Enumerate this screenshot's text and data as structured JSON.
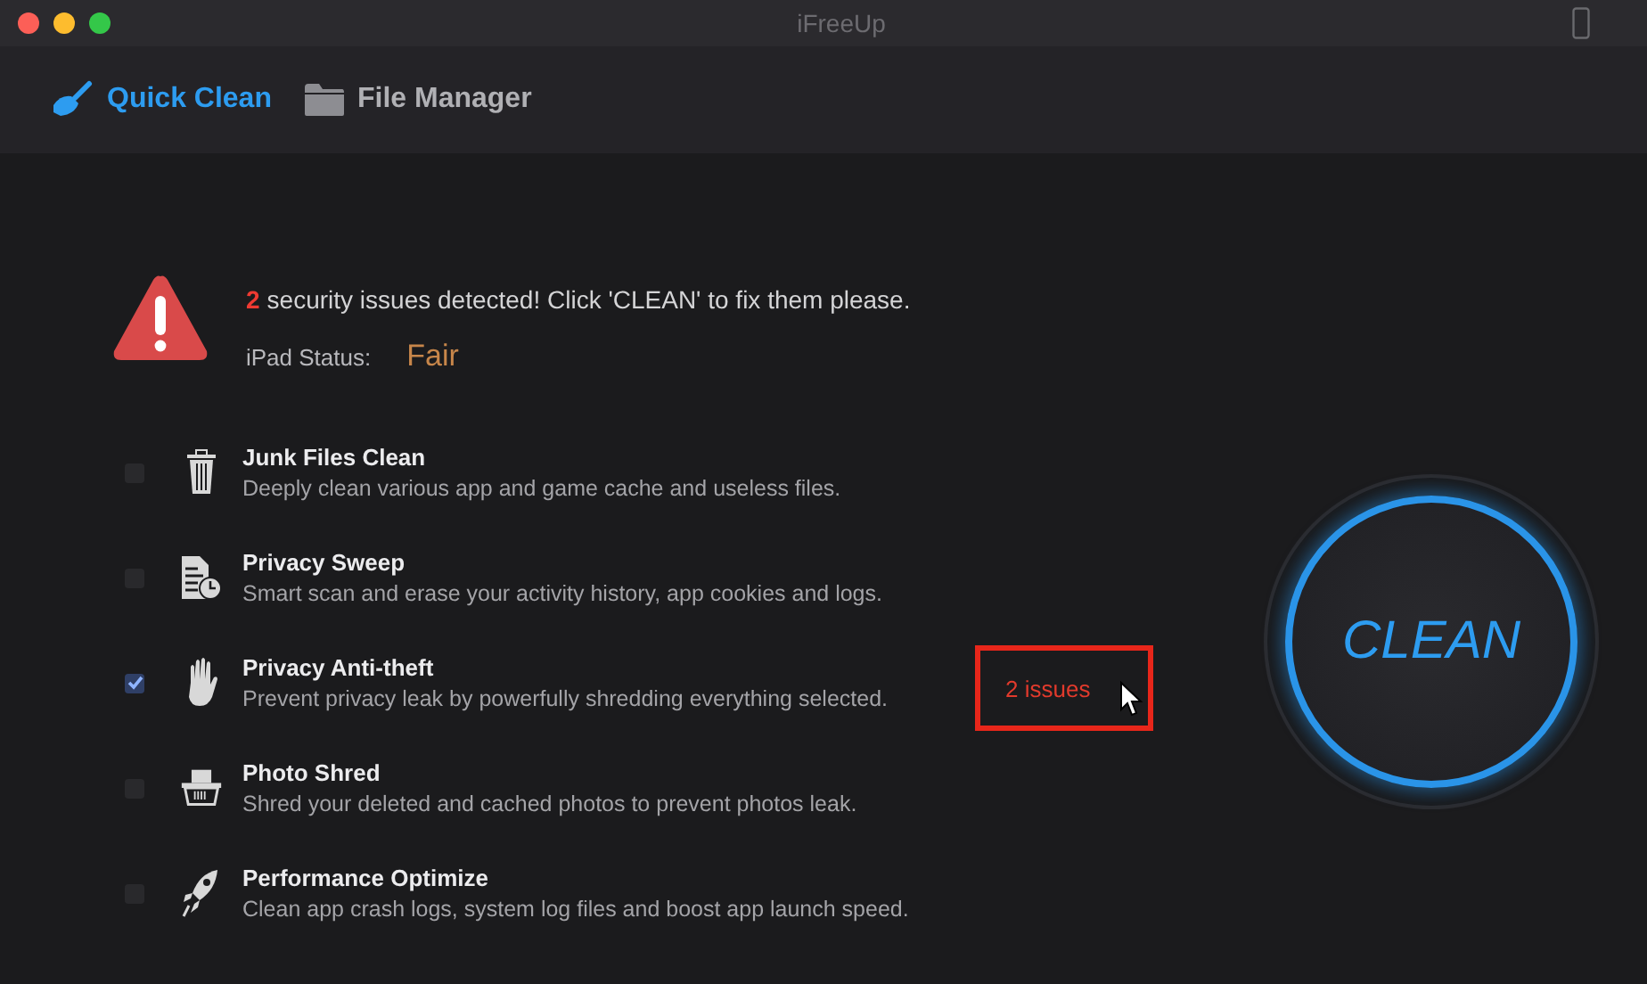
{
  "window": {
    "title": "iFreeUp"
  },
  "tabs": [
    {
      "label": "Quick Clean",
      "selected": true
    },
    {
      "label": "File Manager",
      "selected": false
    }
  ],
  "alert": {
    "count": "2",
    "message": "security issues detected! Click 'CLEAN' to fix them please.",
    "status_label": "iPad Status:",
    "status_value": "Fair"
  },
  "items": [
    {
      "title": "Junk Files Clean",
      "description": "Deeply clean various app and game cache and useless files.",
      "checked": false
    },
    {
      "title": "Privacy Sweep",
      "description": "Smart scan and erase your activity history, app cookies and logs.",
      "checked": false
    },
    {
      "title": "Privacy Anti-theft",
      "description": "Prevent privacy leak by powerfully shredding everything selected.",
      "checked": true,
      "issues": "2 issues"
    },
    {
      "title": "Photo Shred",
      "description": "Shred your deleted and cached photos to prevent photos leak.",
      "checked": false
    },
    {
      "title": "Performance Optimize",
      "description": "Clean app crash logs, system log files and boost app launch speed.",
      "checked": false
    }
  ],
  "clean_button": {
    "label": "CLEAN"
  }
}
